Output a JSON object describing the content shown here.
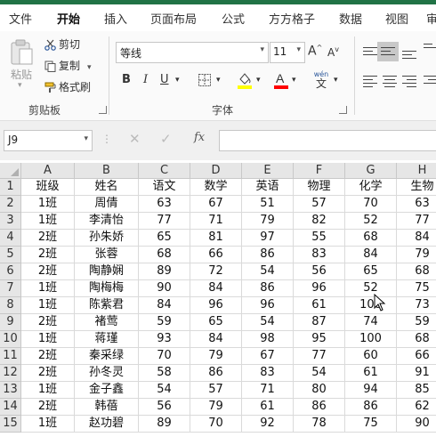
{
  "ribbon_tabs": [
    "文件",
    "开始",
    "插入",
    "页面布局",
    "公式",
    "方方格子",
    "数据",
    "视图",
    "审"
  ],
  "active_tab": "开始",
  "clipboard": {
    "paste": "粘贴",
    "cut": "剪切",
    "copy": "复制",
    "format_painter": "格式刷",
    "group_label": "剪贴板"
  },
  "font": {
    "name": "等线",
    "size": "11",
    "grow": "A",
    "shrink": "A",
    "bold": "B",
    "italic": "I",
    "underline": "U",
    "font_color_letter": "A",
    "phonetic": "wén",
    "phonetic_char": "文",
    "group_label": "字体",
    "highlight_color": "#FFFF00",
    "font_color": "#FF0000"
  },
  "formula_bar": {
    "name_box": "J9",
    "fx": "fx",
    "formula": ""
  },
  "sheet": {
    "column_headers": [
      "A",
      "B",
      "C",
      "D",
      "E",
      "F",
      "G",
      "H"
    ],
    "row_numbers": [
      "1",
      "2",
      "3",
      "4",
      "5",
      "6",
      "7",
      "8",
      "9",
      "10",
      "11",
      "12",
      "13",
      "14",
      "15"
    ],
    "rows": [
      [
        "班级",
        "姓名",
        "语文",
        "数学",
        "英语",
        "物理",
        "化学",
        "生物"
      ],
      [
        "1班",
        "周倩",
        "63",
        "67",
        "51",
        "57",
        "70",
        "63"
      ],
      [
        "1班",
        "李清怡",
        "77",
        "71",
        "79",
        "82",
        "52",
        "77"
      ],
      [
        "2班",
        "孙朱娇",
        "65",
        "81",
        "97",
        "55",
        "68",
        "84"
      ],
      [
        "2班",
        "张蓉",
        "68",
        "66",
        "86",
        "83",
        "84",
        "79"
      ],
      [
        "2班",
        "陶静娴",
        "89",
        "72",
        "54",
        "56",
        "65",
        "68"
      ],
      [
        "1班",
        "陶梅梅",
        "90",
        "84",
        "86",
        "96",
        "52",
        "75"
      ],
      [
        "1班",
        "陈紫君",
        "84",
        "96",
        "96",
        "61",
        "100",
        "73"
      ],
      [
        "2班",
        "褚莺",
        "59",
        "65",
        "54",
        "87",
        "74",
        "59"
      ],
      [
        "1班",
        "蒋瑾",
        "93",
        "84",
        "98",
        "95",
        "100",
        "68"
      ],
      [
        "2班",
        "秦采绿",
        "70",
        "79",
        "67",
        "77",
        "60",
        "66"
      ],
      [
        "2班",
        "孙冬灵",
        "58",
        "86",
        "83",
        "54",
        "61",
        "91"
      ],
      [
        "1班",
        "金子鑫",
        "54",
        "57",
        "71",
        "80",
        "94",
        "85"
      ],
      [
        "2班",
        "韩蓓",
        "56",
        "79",
        "61",
        "86",
        "86",
        "62"
      ],
      [
        "1班",
        "赵功碧",
        "89",
        "70",
        "92",
        "78",
        "75",
        "90"
      ]
    ]
  }
}
